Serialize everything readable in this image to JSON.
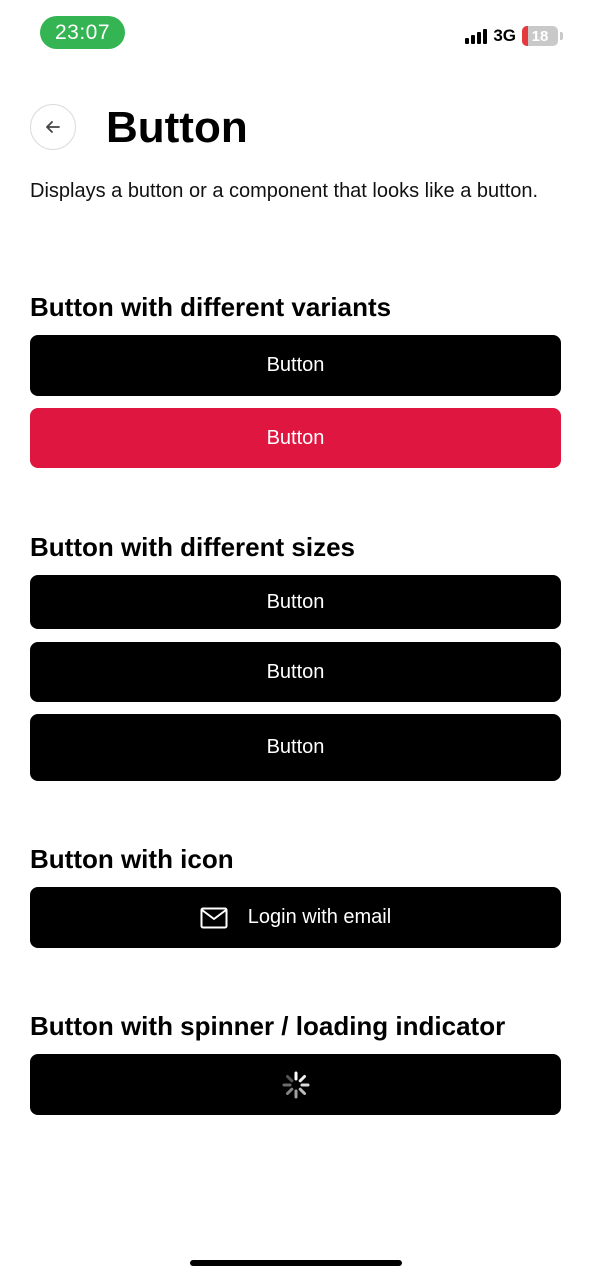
{
  "status_bar": {
    "time": "23:07",
    "network": "3G",
    "battery": "18",
    "battery_level": 0.18,
    "time_bg_color": "#34b452"
  },
  "header": {
    "back_icon": "arrow-left-icon",
    "title": "Button",
    "description": "Displays a button or a component that looks like a button."
  },
  "sections": {
    "variants": {
      "title": "Button with different variants",
      "buttons": [
        {
          "label": "Button",
          "variant": "default",
          "color": "#000000"
        },
        {
          "label": "Button",
          "variant": "destructive",
          "color": "#df1640"
        }
      ]
    },
    "sizes": {
      "title": "Button with different sizes",
      "buttons": [
        {
          "label": "Button",
          "size": "sm"
        },
        {
          "label": "Button",
          "size": "default"
        },
        {
          "label": "Button",
          "size": "lg"
        }
      ]
    },
    "icon": {
      "title": "Button with icon",
      "button": {
        "label": "Login with email",
        "icon": "mail-icon"
      }
    },
    "spinner": {
      "title": "Button with spinner / loading indicator",
      "button": {
        "icon": "spinner-icon"
      }
    }
  }
}
